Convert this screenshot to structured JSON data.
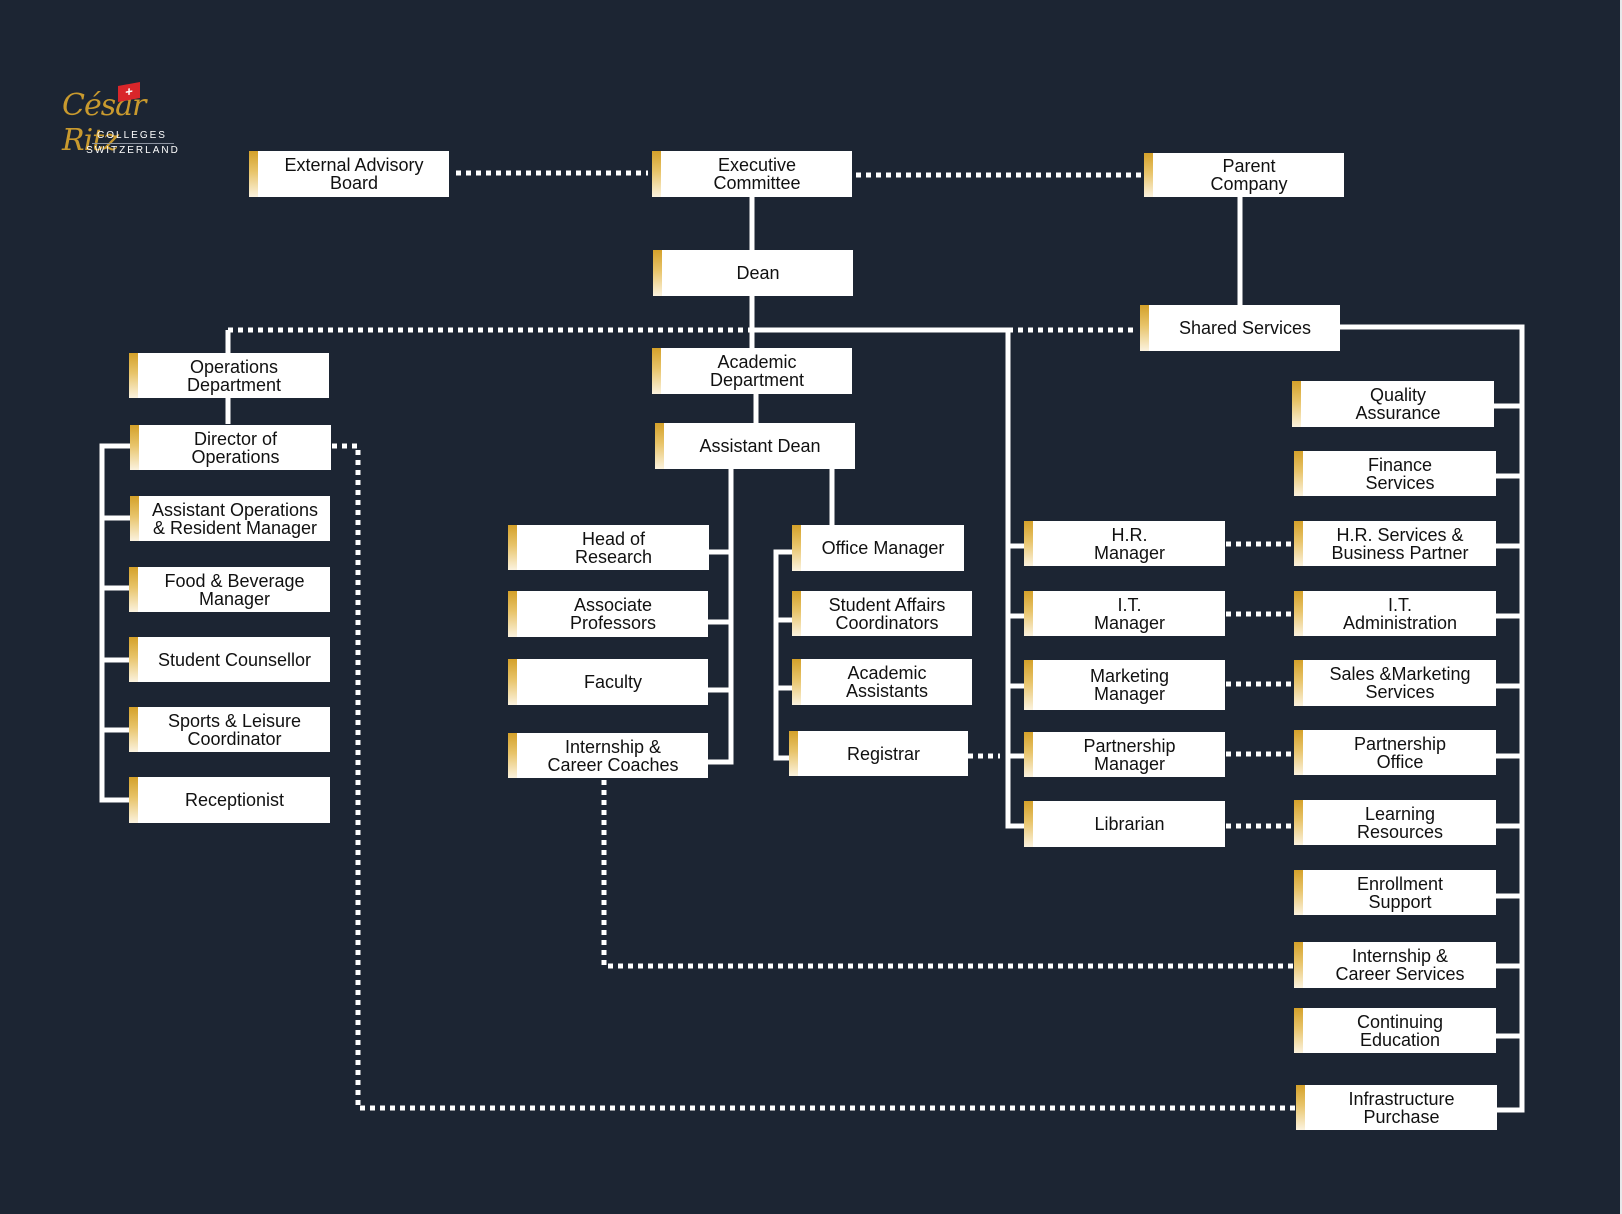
{
  "logo": {
    "brand": "César Ritz",
    "line1": "COLLEGES",
    "line2": "SWITZERLAND",
    "flag_icon": "swiss-flag-icon",
    "brand_color": "#c99a2e"
  },
  "colors": {
    "background": "#1c2533",
    "box": "#ffffff",
    "accent": "#d4a12a",
    "connector": "#ffffff"
  },
  "nodes": {
    "external_advisory_board": "External Advisory\nBoard",
    "executive_committee": "Executive\nCommittee",
    "parent_company": "Parent\nCompany",
    "dean": "Dean",
    "shared_services": "Shared Services",
    "operations_department": "Operations\nDepartment",
    "director_of_operations": "Director of\nOperations",
    "assistant_operations": "Assistant Operations\n& Resident Manager",
    "food_beverage_manager": "Food & Beverage\nManager",
    "student_counsellor": "Student Counsellor",
    "sports_leisure_coordinator": "Sports & Leisure\nCoordinator",
    "receptionist": "Receptionist",
    "academic_department": "Academic\nDepartment",
    "assistant_dean": "Assistant Dean",
    "head_of_research": "Head of\nResearch",
    "associate_professors": "Associate\nProfessors",
    "faculty": "Faculty",
    "internship_career_coaches": "Internship &\nCareer Coaches",
    "office_manager": "Office Manager",
    "student_affairs_coordinators": "Student Affairs\nCoordinators",
    "academic_assistants": "Academic\nAssistants",
    "registrar": "Registrar",
    "hr_manager": "H.R.\nManager",
    "it_manager": "I.T.\nManager",
    "marketing_manager": "Marketing\nManager",
    "partnership_manager": "Partnership\nManager",
    "librarian": "Librarian",
    "quality_assurance": "Quality\nAssurance",
    "finance_services": "Finance\nServices",
    "hr_services": "H.R. Services &\nBusiness Partner",
    "it_administration": "I.T.\nAdministration",
    "sales_marketing_services": "Sales &Marketing\nServices",
    "partnership_office": "Partnership\nOffice",
    "learning_resources": "Learning\nResources",
    "enrollment_support": "Enrollment\nSupport",
    "internship_career_services": "Internship &\nCareer Services",
    "continuing_education": "Continuing\nEducation",
    "infrastructure_purchase": "Infrastructure\nPurchase"
  },
  "relationships": {
    "solid": [
      [
        "executive_committee",
        "dean"
      ],
      [
        "parent_company",
        "shared_services"
      ],
      [
        "dean",
        "academic_department"
      ],
      [
        "dean",
        "hr_manager"
      ],
      [
        "dean",
        "it_manager"
      ],
      [
        "dean",
        "marketing_manager"
      ],
      [
        "dean",
        "partnership_manager"
      ],
      [
        "dean",
        "librarian"
      ],
      [
        "operations_department",
        "director_of_operations"
      ],
      [
        "director_of_operations",
        "assistant_operations"
      ],
      [
        "director_of_operations",
        "food_beverage_manager"
      ],
      [
        "director_of_operations",
        "student_counsellor"
      ],
      [
        "director_of_operations",
        "sports_leisure_coordinator"
      ],
      [
        "director_of_operations",
        "receptionist"
      ],
      [
        "academic_department",
        "assistant_dean"
      ],
      [
        "assistant_dean",
        "head_of_research"
      ],
      [
        "assistant_dean",
        "associate_professors"
      ],
      [
        "assistant_dean",
        "faculty"
      ],
      [
        "assistant_dean",
        "internship_career_coaches"
      ],
      [
        "assistant_dean",
        "office_manager"
      ],
      [
        "office_manager",
        "student_affairs_coordinators"
      ],
      [
        "office_manager",
        "academic_assistants"
      ],
      [
        "office_manager",
        "registrar"
      ],
      [
        "shared_services",
        "quality_assurance"
      ],
      [
        "shared_services",
        "finance_services"
      ],
      [
        "shared_services",
        "hr_services"
      ],
      [
        "shared_services",
        "it_administration"
      ],
      [
        "shared_services",
        "sales_marketing_services"
      ],
      [
        "shared_services",
        "partnership_office"
      ],
      [
        "shared_services",
        "learning_resources"
      ],
      [
        "shared_services",
        "enrollment_support"
      ],
      [
        "shared_services",
        "internship_career_services"
      ],
      [
        "shared_services",
        "continuing_education"
      ],
      [
        "shared_services",
        "infrastructure_purchase"
      ]
    ],
    "dotted": [
      [
        "external_advisory_board",
        "executive_committee"
      ],
      [
        "executive_committee",
        "parent_company"
      ],
      [
        "dean",
        "operations_department"
      ],
      [
        "dean",
        "shared_services"
      ],
      [
        "director_of_operations",
        "infrastructure_purchase"
      ],
      [
        "internship_career_coaches",
        "internship_career_services"
      ],
      [
        "registrar",
        "partnership_manager"
      ],
      [
        "hr_manager",
        "hr_services"
      ],
      [
        "it_manager",
        "it_administration"
      ],
      [
        "marketing_manager",
        "sales_marketing_services"
      ],
      [
        "partnership_manager",
        "partnership_office"
      ],
      [
        "librarian",
        "learning_resources"
      ]
    ]
  }
}
